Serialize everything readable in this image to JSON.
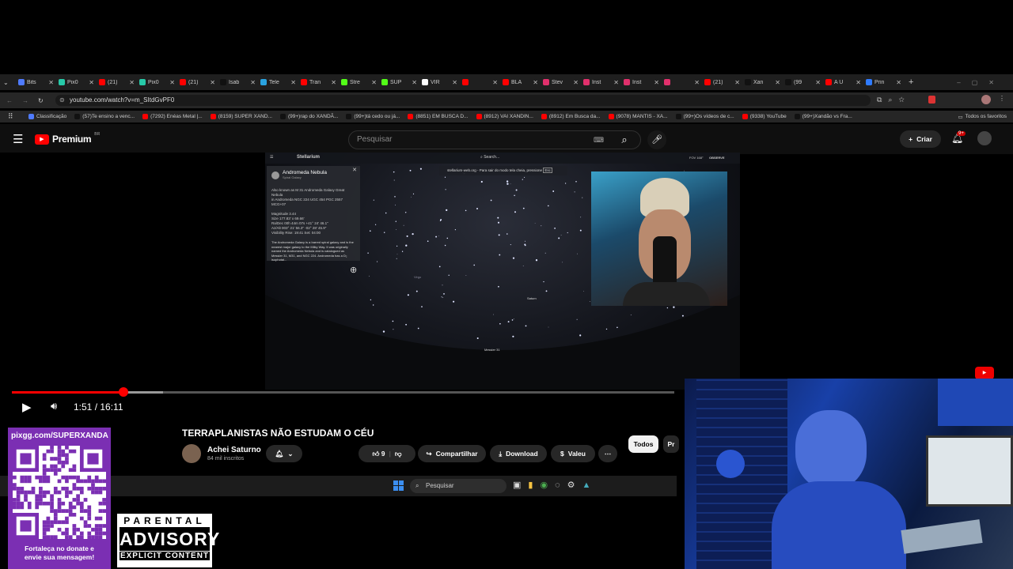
{
  "browser": {
    "tabs": [
      {
        "label": "Bits",
        "color": "#4f7bff"
      },
      {
        "label": "Pix0",
        "color": "#27c9a8"
      },
      {
        "label": "(21)",
        "color": "#ff0000"
      },
      {
        "label": "Pix0",
        "color": "#27c9a8"
      },
      {
        "label": "(21)",
        "color": "#ff0000"
      },
      {
        "label": "Isab",
        "color": "#111111"
      },
      {
        "label": "Tele",
        "color": "#2aa3e0"
      },
      {
        "label": "Tran",
        "color": "#ff0000"
      },
      {
        "label": "Stre",
        "color": "#53fc18"
      },
      {
        "label": "SUP",
        "color": "#53fc18"
      },
      {
        "label": "VIR",
        "color": "#ffffff"
      },
      {
        "label": "",
        "color": "#ff0000"
      },
      {
        "label": "BLA",
        "color": "#ff0000"
      },
      {
        "label": "Stev",
        "color": "#e1306c"
      },
      {
        "label": "Inst",
        "color": "#e1306c"
      },
      {
        "label": "Inst",
        "color": "#e1306c"
      },
      {
        "label": "",
        "color": "#e1306c"
      },
      {
        "label": "(21)",
        "color": "#ff0000"
      },
      {
        "label": "Xan",
        "color": "#111111"
      },
      {
        "label": "(99",
        "color": "#111111"
      },
      {
        "label": "A U",
        "color": "#ff0000"
      },
      {
        "label": "Prin",
        "color": "#2f7bff"
      }
    ],
    "url": "youtube.com/watch?v=m_SItdGvPF0",
    "bookmarks": [
      {
        "label": "Classificação",
        "color": "#4f7bff"
      },
      {
        "label": "(57)Te ensino a venc...",
        "color": "#111111"
      },
      {
        "label": "(7292) Enéas Metal |...",
        "color": "#ff0000"
      },
      {
        "label": "(8159) SUPER XAND...",
        "color": "#ff0000"
      },
      {
        "label": "(99+)rap do XANDÃ...",
        "color": "#111111"
      },
      {
        "label": "(99+)tá cedo ou já...",
        "color": "#111111"
      },
      {
        "label": "(8851) EM BUSCA D...",
        "color": "#ff0000"
      },
      {
        "label": "(8912) VAI XANDIN...",
        "color": "#ff0000"
      },
      {
        "label": "(8912) Em Busca da...",
        "color": "#ff0000"
      },
      {
        "label": "(9078) MANTIS - XA...",
        "color": "#ff0000"
      },
      {
        "label": "(99+)Os vídeos de c...",
        "color": "#111111"
      },
      {
        "label": "(9338) YouTube",
        "color": "#ff0000"
      },
      {
        "label": "(99+)Xandão vs Fra...",
        "color": "#111111"
      }
    ],
    "all_favorites": "Todos os favoritos"
  },
  "youtube": {
    "logo": "Premium",
    "country": "BR",
    "search_placeholder": "Pesquisar",
    "create_label": "Criar",
    "notif_badge": "9+",
    "time_display": "1:51 / 16:11",
    "progress_fraction": 0.168,
    "video_title": "TERRAPLANISTAS NÃO ESTUDAM O CÉU",
    "channel_name": "Achei Saturno",
    "subscribers": "84 mil inscritos",
    "likes": "9",
    "share_label": "Compartilhar",
    "download_label": "Download",
    "thanks_label": "Valeu",
    "filter_all": "Todos",
    "filter_next": "Pr"
  },
  "stellarium": {
    "app": "Stellarium",
    "search_placeholder": "Search...",
    "fullscreen_notice": "stellarium-web.org - Para sair do modo tela cheia, pressione",
    "fullscreen_key": "Esc",
    "object_name": "Andromeda Nebula",
    "object_type": "Spiral Galaxy",
    "labels": {
      "saturn": "Saturn",
      "virgo": "Virgo",
      "messier": "Messier 31"
    },
    "fov": "FOV 168°",
    "observe": "OBSERVE",
    "info_lines": [
      "Also known as  M 31  Andromeda Galaxy  Great Nebula",
      "in Andromeda  NGC 224  UGC 454  PGC 2557  MCG+07",
      "Magnitude  3.44",
      "Size  177.83' x 69.66'",
      "Ra/Dec  00h 44m 07s  +41° 24' 46.1\"",
      "Az/Alt  003° 21' 56.3\"  -02° 28' 45.9\"",
      "Visibility  Rise: 19:41  Set: 04:00"
    ],
    "description": "The Andromeda Galaxy is a barred spiral galaxy and is the nearest major galaxy to the Milky Way. It was originally named the Andromeda Nebula and is catalogued as Messier 31, M31, and NGC 224. Andromeda has a D₂ isophotal..."
  },
  "taskbar": {
    "search_placeholder": "Pesquisar"
  },
  "overlay": {
    "qr_title": "pixgg.com/SUPERXANDA",
    "qr_caption_line1": "Fortaleça no donate e",
    "qr_caption_line2": "envie sua mensagem!",
    "advisory_top": "PARENTAL",
    "advisory_main": "ADVISORY",
    "advisory_bottom": "EXPLICIT CONTENT"
  },
  "colors": {
    "yt_red": "#ff0000",
    "qr_purple": "#7b2fb3",
    "chrome_dark": "#1f1f1f"
  }
}
